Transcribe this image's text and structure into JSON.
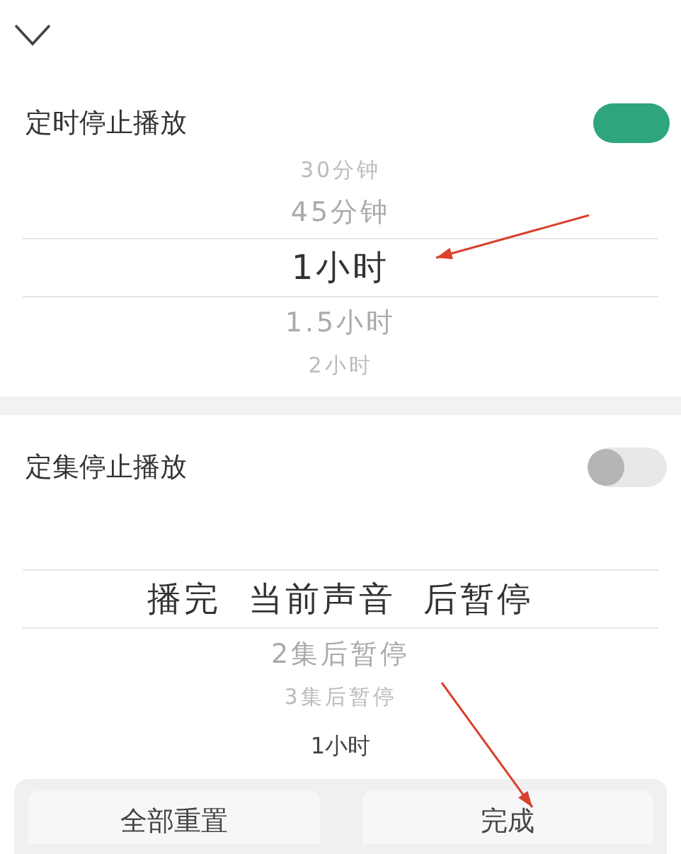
{
  "sections": [
    {
      "title": "定时停止播放",
      "on": true,
      "picker": [
        {
          "label": "30分钟",
          "selected": false
        },
        {
          "label": "45分钟",
          "selected": false
        },
        {
          "label": "1小时",
          "selected": true
        },
        {
          "label": "1.5小时",
          "selected": false
        },
        {
          "label": "2小时",
          "selected": false
        }
      ]
    },
    {
      "title": "定集停止播放",
      "on": false,
      "picker": [
        {
          "label": "播完  当前声音  后暂停",
          "selected": true
        },
        {
          "label": "2集后暂停",
          "selected": false
        },
        {
          "label": "3集后暂停",
          "selected": false
        }
      ]
    }
  ],
  "summary": "1小时",
  "buttons": [
    "全部重置",
    "完成"
  ]
}
